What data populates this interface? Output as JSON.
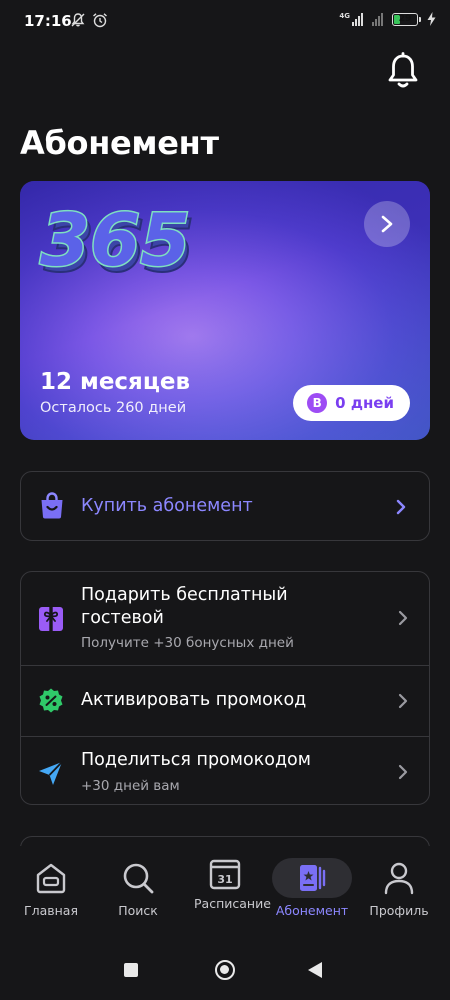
{
  "status_bar": {
    "time": "17:16",
    "network_type": "4G",
    "battery_level": "29",
    "battery_percent": 29
  },
  "header": {
    "title": "Абонемент"
  },
  "subscription_card": {
    "logo_text": "365",
    "period": "12 месяцев",
    "remaining": "Осталось 260 дней",
    "bonus_badge_letter": "B",
    "bonus_days": "0 дней"
  },
  "buy": {
    "label": "Купить абонемент"
  },
  "options": [
    {
      "title": "Подарить бесплатный гостевой",
      "subtitle": "Получите +30 бонусных дней",
      "icon": "gift-icon"
    },
    {
      "title": "Активировать промокод",
      "subtitle": "",
      "icon": "percent-badge-icon"
    },
    {
      "title": "Поделиться промокодом",
      "subtitle": "+30 дней вам",
      "icon": "send-icon"
    }
  ],
  "bottom_nav": [
    {
      "label": "Главная",
      "icon": "home-icon",
      "active": false
    },
    {
      "label": "Поиск",
      "icon": "search-icon",
      "active": false
    },
    {
      "label": "Расписание",
      "icon": "calendar-icon",
      "calendar_day": "31",
      "active": false
    },
    {
      "label": "Абонемент",
      "icon": "membership-card-icon",
      "active": true
    },
    {
      "label": "Профиль",
      "icon": "profile-icon",
      "active": false
    }
  ],
  "colors": {
    "background": "#161618",
    "accent": "#8c87ff",
    "card_gradient_start": "#3c2fb6",
    "card_gradient_mid": "#a477ee",
    "badge_purple": "#9d4cf4",
    "divider": "#37373b"
  }
}
